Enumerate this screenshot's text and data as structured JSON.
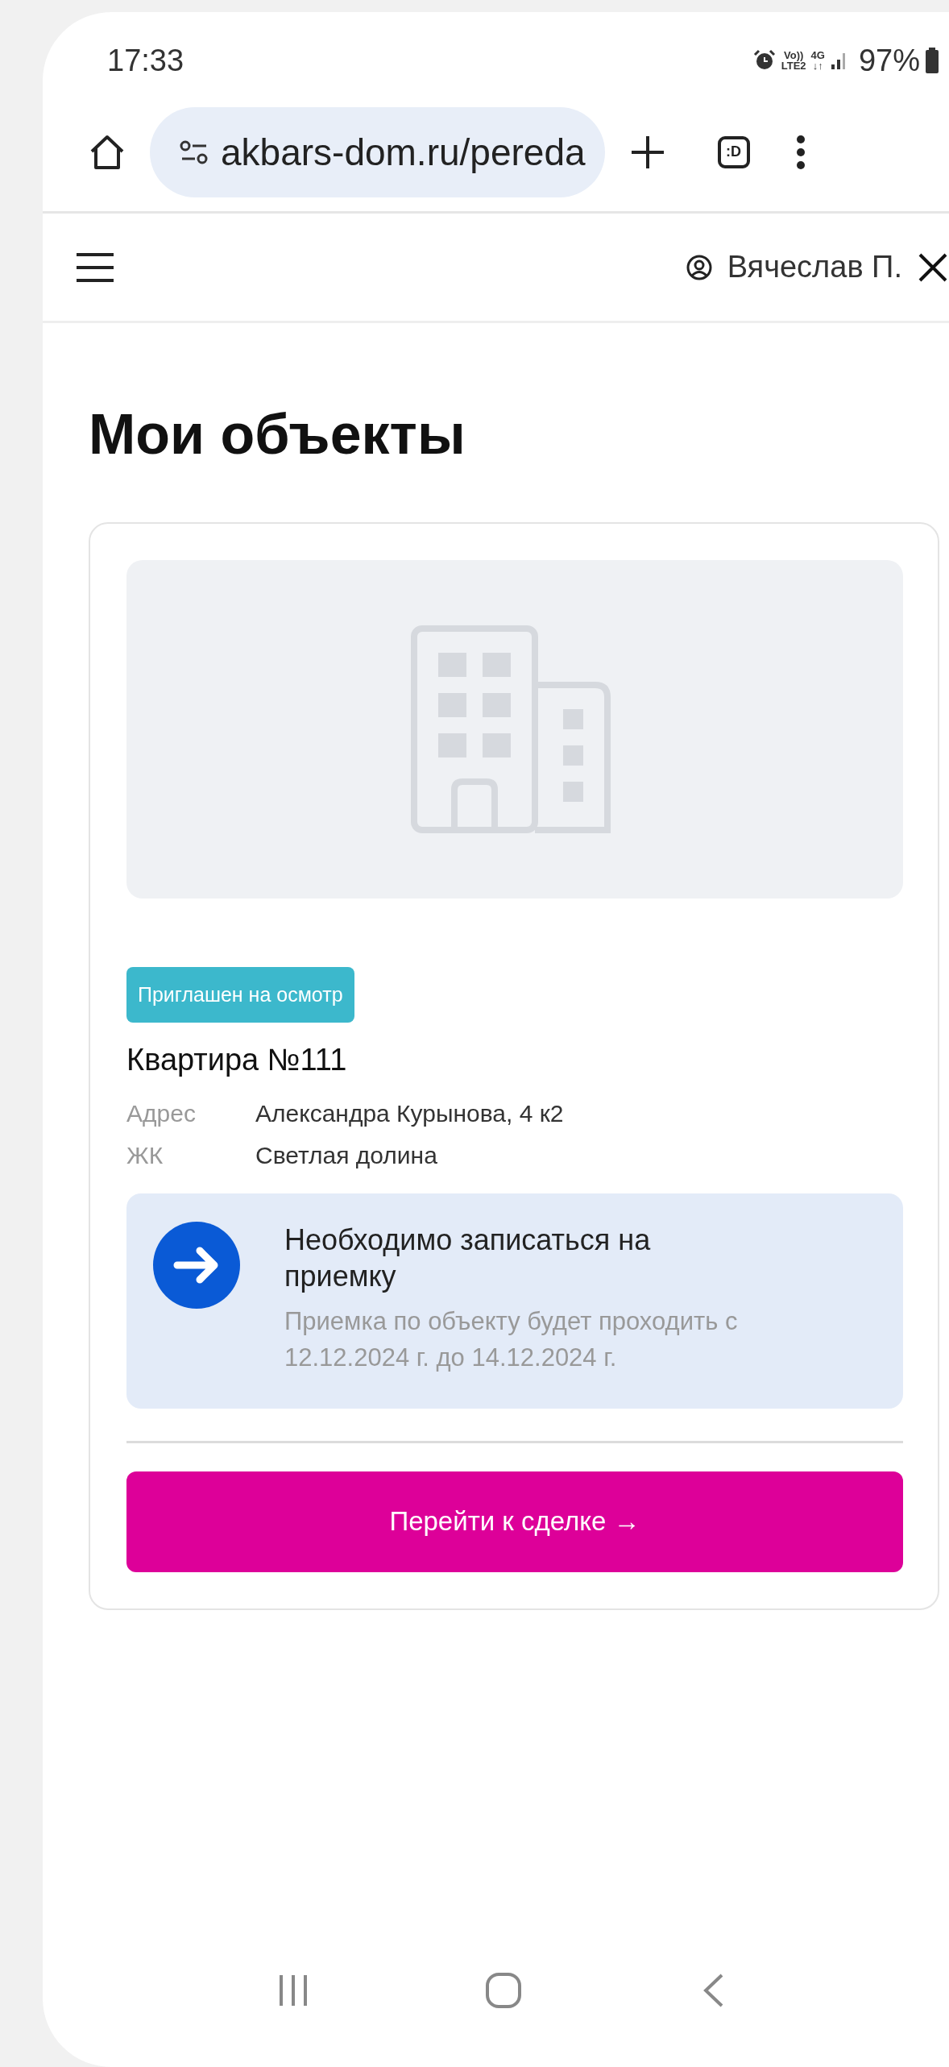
{
  "status_bar": {
    "time": "17:33",
    "network": [
      {
        "top": "Vo))",
        "bottom": "LTE2"
      },
      {
        "top": "4G",
        "bottom": "↓↑"
      }
    ],
    "battery": "97%"
  },
  "browser": {
    "url": "akbars-dom.ru/pereda",
    "tabs_icon": ":D"
  },
  "header": {
    "user": "Вячеслав П."
  },
  "page": {
    "title": "Мои объекты"
  },
  "object": {
    "status": "Приглашен на осмотр",
    "name": "Квартира №111",
    "details": [
      {
        "label": "Адрес",
        "value": "Александра Курынова, 4 к2"
      },
      {
        "label": "ЖК",
        "value": "Светлая долина"
      }
    ],
    "notice": {
      "title": "Необходимо записаться на приемку",
      "text": "Приемка по объекту будет проходить с 12.12.2024 г. до 14.12.2024 г."
    },
    "button": "Перейти к сделке →"
  }
}
